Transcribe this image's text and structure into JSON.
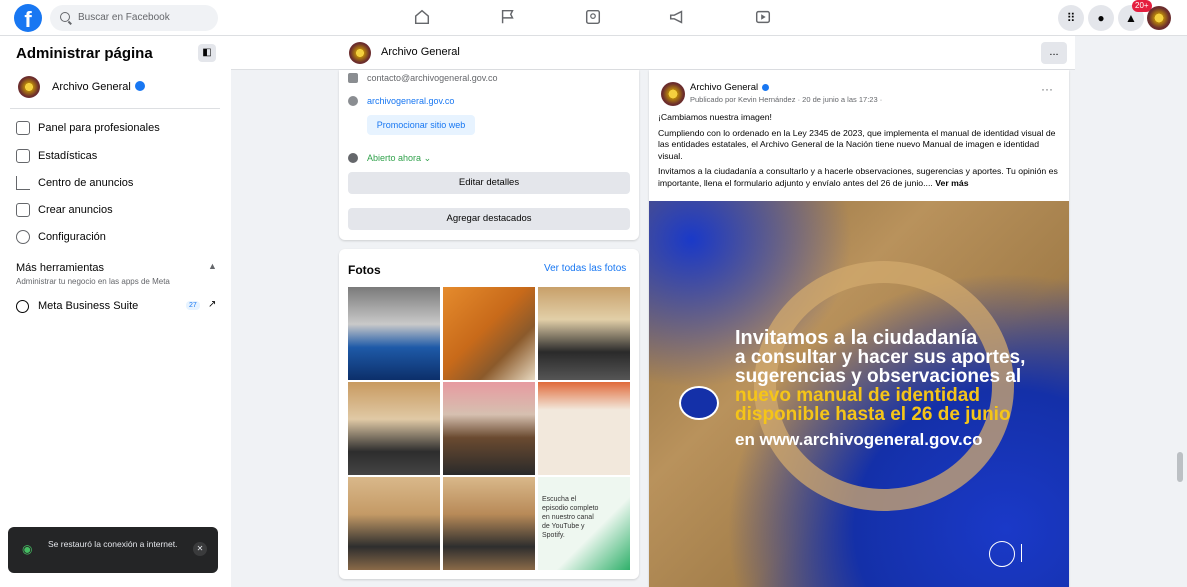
{
  "topbar": {
    "search_placeholder": "Buscar en Facebook",
    "notification_badge": "20+"
  },
  "sidebar": {
    "title": "Administrar página",
    "page_name": "Archivo General",
    "items": [
      {
        "label": "Panel para profesionales",
        "icon": "dashboard-icon"
      },
      {
        "label": "Estadísticas",
        "icon": "insights-icon"
      },
      {
        "label": "Centro de anuncios",
        "icon": "megaphone-icon"
      },
      {
        "label": "Crear anuncios",
        "icon": "edit-icon"
      },
      {
        "label": "Configuración",
        "icon": "gear-icon"
      }
    ],
    "tools_title": "Más herramientas",
    "tools_subtitle": "Administrar tu negocio en las apps de Meta",
    "meta_suite": {
      "label": "Meta Business Suite",
      "count": "27"
    }
  },
  "toast": {
    "message": "Se restauró la conexión a internet."
  },
  "page_header": {
    "name": "Archivo General",
    "more": "..."
  },
  "intro": {
    "email": "contacto@archivogeneral.gov.co",
    "website": "archivogeneral.gov.co",
    "promote": "Promocionar sitio web",
    "hours": "Abierto ahora",
    "edit_details": "Editar detalles",
    "add_featured": "Agregar destacados"
  },
  "photos": {
    "title": "Fotos",
    "see_all": "Ver todas las fotos",
    "caption_last": "Escucha el episodio completo en nuestro canal de YouTube y Spotify."
  },
  "post": {
    "author": "Archivo General",
    "meta": "Publicado por Kevin Hernández · 20 de junio a las 17:23 ·",
    "line1": "¡Cambiamos nuestra imagen!",
    "para1": "Cumpliendo con lo ordenado en la Ley 2345 de 2023, que implementa el manual de identidad visual de las entidades estatales, el Archivo General de la Nación tiene nuevo Manual de imagen e identidad visual.",
    "para2": "Invitamos a la ciudadanía a consultarlo y a hacerle observaciones, sugerencias y aportes. Tu opinión es importante, llena el formulario adjunto y envíalo antes del 26 de junio.... ",
    "see_more": "Ver más",
    "image_text": {
      "l1": "Invitamos a la ciudadanía",
      "l2": "a consultar y hacer sus aportes,",
      "l3": "sugerencias y observaciones al",
      "l4": "nuevo manual de identidad",
      "l5": "disponible hasta el 26 de junio",
      "l6": "en www.archivogeneral.gov.co"
    }
  },
  "colors": {
    "brand": "#1877f2",
    "image_blue": "#1430a8",
    "highlight_yellow": "#f5c518"
  }
}
